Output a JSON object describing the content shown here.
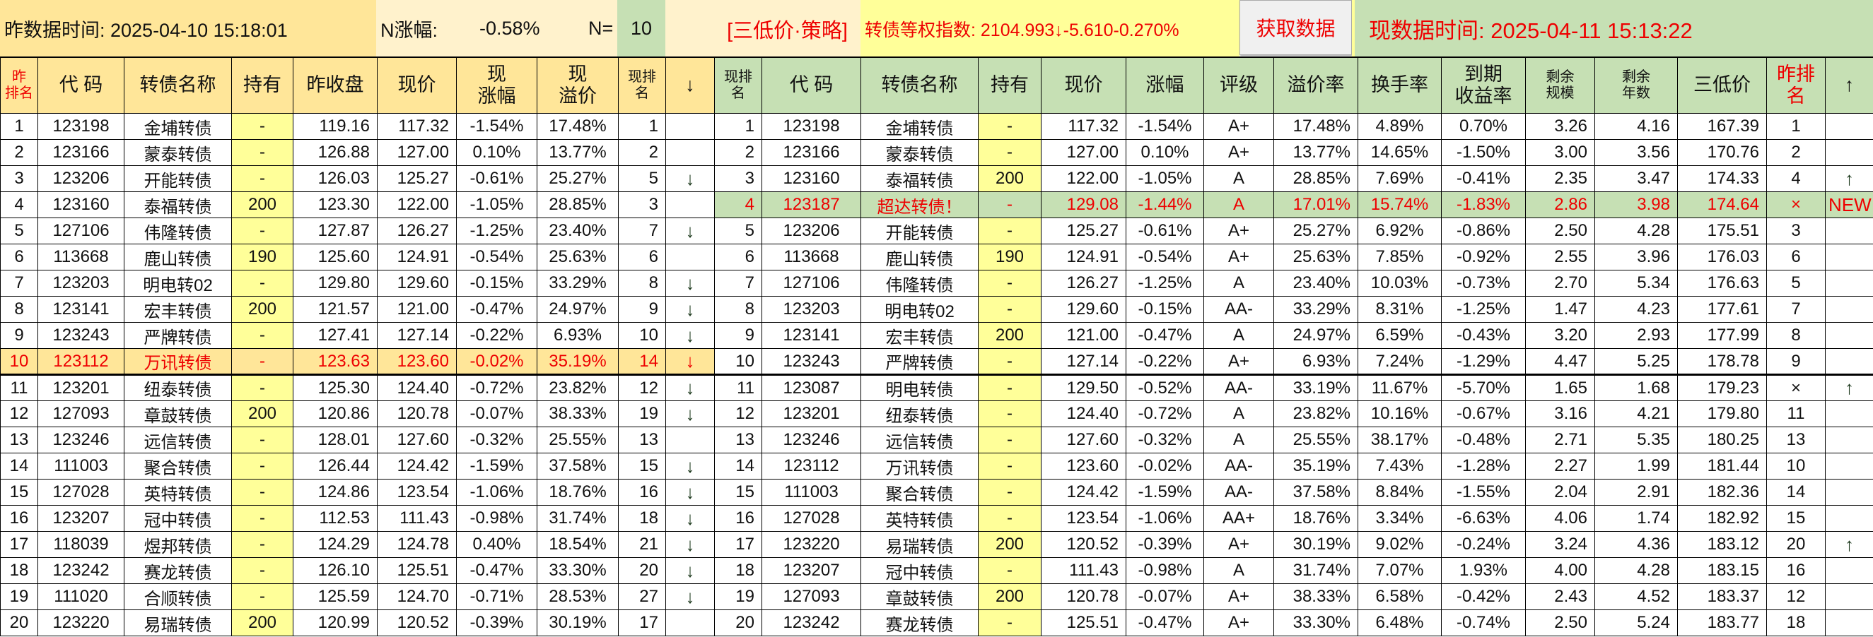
{
  "top": {
    "yesterday_time": "昨数据时间: 2025-04-10 15:18:01",
    "n_change_label": "N涨幅:",
    "n_change_value": "-0.58%",
    "n_label": "N=",
    "n_value": "10",
    "strategy": "[三低价·策略]",
    "index_text": "转债等权指数:  2104.993↓-5.610-0.270%",
    "fetch_button": "获取数据",
    "now_time": "现数据时间: 2025-04-11 15:13:22"
  },
  "colors": {
    "left_header": "#ffe699",
    "right_header": "#c6e0b4",
    "hold": "#ffff99",
    "alert": "#ff0000"
  },
  "left": {
    "headers": [
      "昨\n排名",
      "代 码",
      "转债名称",
      "持有",
      "昨收盘",
      "现价",
      "现\n涨幅",
      "现\n溢价",
      "现排名",
      "↓"
    ],
    "rows": [
      [
        "1",
        "123198",
        "金埔转债",
        "-",
        "119.16",
        "117.32",
        "-1.54%",
        "17.48%",
        "1",
        ""
      ],
      [
        "2",
        "123166",
        "蒙泰转债",
        "-",
        "126.88",
        "127.00",
        "0.10%",
        "13.77%",
        "2",
        ""
      ],
      [
        "3",
        "123206",
        "开能转债",
        "-",
        "126.03",
        "125.27",
        "-0.61%",
        "25.27%",
        "5",
        "↓"
      ],
      [
        "4",
        "123160",
        "泰福转债",
        "200",
        "123.30",
        "122.00",
        "-1.05%",
        "28.85%",
        "3",
        ""
      ],
      [
        "5",
        "127106",
        "伟隆转债",
        "-",
        "127.87",
        "126.27",
        "-1.25%",
        "23.40%",
        "7",
        "↓"
      ],
      [
        "6",
        "113668",
        "鹿山转债",
        "190",
        "125.60",
        "124.91",
        "-0.54%",
        "25.63%",
        "6",
        ""
      ],
      [
        "7",
        "123203",
        "明电转02",
        "-",
        "129.80",
        "129.60",
        "-0.15%",
        "33.29%",
        "8",
        "↓"
      ],
      [
        "8",
        "123141",
        "宏丰转债",
        "200",
        "121.57",
        "121.00",
        "-0.47%",
        "24.97%",
        "9",
        "↓"
      ],
      [
        "9",
        "123243",
        "严牌转债",
        "-",
        "127.41",
        "127.14",
        "-0.22%",
        "6.93%",
        "10",
        "↓"
      ],
      [
        "10",
        "123112",
        "万讯转债",
        "-",
        "123.63",
        "123.60",
        "-0.02%",
        "35.19%",
        "14",
        "↓"
      ],
      [
        "11",
        "123201",
        "纽泰转债",
        "-",
        "125.30",
        "124.40",
        "-0.72%",
        "23.82%",
        "12",
        "↓"
      ],
      [
        "12",
        "127093",
        "章鼓转债",
        "200",
        "120.86",
        "120.78",
        "-0.07%",
        "38.33%",
        "19",
        "↓"
      ],
      [
        "13",
        "123246",
        "远信转债",
        "-",
        "128.01",
        "127.60",
        "-0.32%",
        "25.55%",
        "13",
        ""
      ],
      [
        "14",
        "111003",
        "聚合转债",
        "-",
        "126.44",
        "124.42",
        "-1.59%",
        "37.58%",
        "15",
        "↓"
      ],
      [
        "15",
        "127028",
        "英特转债",
        "-",
        "124.86",
        "123.54",
        "-1.06%",
        "18.76%",
        "16",
        "↓"
      ],
      [
        "16",
        "123207",
        "冠中转债",
        "-",
        "112.53",
        "111.43",
        "-0.98%",
        "31.74%",
        "18",
        "↓"
      ],
      [
        "17",
        "118039",
        "煜邦转债",
        "-",
        "124.29",
        "124.78",
        "0.40%",
        "18.54%",
        "21",
        "↓"
      ],
      [
        "18",
        "123242",
        "赛龙转债",
        "-",
        "126.10",
        "125.51",
        "-0.47%",
        "33.30%",
        "20",
        "↓"
      ],
      [
        "19",
        "111020",
        "合顺转债",
        "-",
        "125.59",
        "124.70",
        "-0.71%",
        "28.53%",
        "27",
        "↓"
      ],
      [
        "20",
        "123220",
        "易瑞转债",
        "200",
        "120.99",
        "120.52",
        "-0.39%",
        "30.19%",
        "17",
        ""
      ]
    ],
    "highlight_row": 10
  },
  "right": {
    "headers": [
      "现排名",
      "代 码",
      "转债名称",
      "持有",
      "现价",
      "涨幅",
      "评级",
      "溢价率",
      "换手率",
      "到期\n收益率",
      "剩余\n规模",
      "剩余\n年数",
      "三低价",
      "昨排名",
      "↑"
    ],
    "rows": [
      [
        "1",
        "123198",
        "金埔转债",
        "-",
        "117.32",
        "-1.54%",
        "A+",
        "17.48%",
        "4.89%",
        "0.70%",
        "3.26",
        "4.16",
        "167.39",
        "1",
        ""
      ],
      [
        "2",
        "123166",
        "蒙泰转债",
        "-",
        "127.00",
        "0.10%",
        "A+",
        "13.77%",
        "14.65%",
        "-1.50%",
        "3.00",
        "3.56",
        "170.76",
        "2",
        ""
      ],
      [
        "3",
        "123160",
        "泰福转债",
        "200",
        "122.00",
        "-1.05%",
        "A",
        "28.85%",
        "7.69%",
        "-0.41%",
        "2.35",
        "3.47",
        "174.33",
        "4",
        "↑"
      ],
      [
        "4",
        "123187",
        "超达转债！",
        "-",
        "129.08",
        "-1.44%",
        "A",
        "17.01%",
        "15.74%",
        "-1.83%",
        "2.86",
        "3.98",
        "174.64",
        "×",
        "NEW"
      ],
      [
        "5",
        "123206",
        "开能转债",
        "-",
        "125.27",
        "-0.61%",
        "A+",
        "25.27%",
        "6.92%",
        "-0.86%",
        "2.50",
        "4.28",
        "175.51",
        "3",
        ""
      ],
      [
        "6",
        "113668",
        "鹿山转债",
        "190",
        "124.91",
        "-0.54%",
        "A+",
        "25.63%",
        "7.85%",
        "-0.92%",
        "2.55",
        "3.96",
        "176.03",
        "6",
        ""
      ],
      [
        "7",
        "127106",
        "伟隆转债",
        "-",
        "126.27",
        "-1.25%",
        "A",
        "23.40%",
        "10.03%",
        "-0.73%",
        "2.70",
        "5.34",
        "176.63",
        "5",
        ""
      ],
      [
        "8",
        "123203",
        "明电转02",
        "-",
        "129.60",
        "-0.15%",
        "AA-",
        "33.29%",
        "8.31%",
        "-1.25%",
        "1.47",
        "4.23",
        "177.61",
        "7",
        ""
      ],
      [
        "9",
        "123141",
        "宏丰转债",
        "200",
        "121.00",
        "-0.47%",
        "A",
        "24.97%",
        "6.59%",
        "-0.43%",
        "3.20",
        "2.93",
        "177.99",
        "8",
        ""
      ],
      [
        "10",
        "123243",
        "严牌转债",
        "-",
        "127.14",
        "-0.22%",
        "A+",
        "6.93%",
        "7.24%",
        "-1.29%",
        "4.47",
        "5.25",
        "178.78",
        "9",
        ""
      ],
      [
        "11",
        "123087",
        "明电转债",
        "-",
        "129.50",
        "-0.52%",
        "AA-",
        "33.19%",
        "11.67%",
        "-5.70%",
        "1.65",
        "1.68",
        "179.23",
        "×",
        "↑"
      ],
      [
        "12",
        "123201",
        "纽泰转债",
        "-",
        "124.40",
        "-0.72%",
        "A",
        "23.82%",
        "10.16%",
        "-0.67%",
        "3.16",
        "4.21",
        "179.80",
        "11",
        ""
      ],
      [
        "13",
        "123246",
        "远信转债",
        "-",
        "127.60",
        "-0.32%",
        "A",
        "25.55%",
        "38.17%",
        "-0.48%",
        "2.71",
        "5.35",
        "180.25",
        "13",
        ""
      ],
      [
        "14",
        "123112",
        "万讯转债",
        "-",
        "123.60",
        "-0.02%",
        "AA-",
        "35.19%",
        "7.43%",
        "-1.28%",
        "2.27",
        "1.99",
        "181.44",
        "10",
        ""
      ],
      [
        "15",
        "111003",
        "聚合转债",
        "-",
        "124.42",
        "-1.59%",
        "AA-",
        "37.58%",
        "8.84%",
        "-1.55%",
        "2.04",
        "2.91",
        "182.36",
        "14",
        ""
      ],
      [
        "16",
        "127028",
        "英特转债",
        "-",
        "123.54",
        "-1.06%",
        "AA+",
        "18.76%",
        "3.34%",
        "-6.63%",
        "4.06",
        "1.74",
        "182.92",
        "15",
        ""
      ],
      [
        "17",
        "123220",
        "易瑞转债",
        "200",
        "120.52",
        "-0.39%",
        "A+",
        "30.19%",
        "9.02%",
        "-0.24%",
        "3.24",
        "4.36",
        "183.12",
        "20",
        "↑"
      ],
      [
        "18",
        "123207",
        "冠中转债",
        "-",
        "111.43",
        "-0.98%",
        "A",
        "31.74%",
        "7.07%",
        "1.93%",
        "4.00",
        "4.28",
        "183.15",
        "16",
        ""
      ],
      [
        "19",
        "127093",
        "章鼓转债",
        "200",
        "120.78",
        "-0.07%",
        "A+",
        "38.33%",
        "6.58%",
        "-0.42%",
        "2.43",
        "4.52",
        "183.37",
        "12",
        ""
      ],
      [
        "20",
        "123242",
        "赛龙转债",
        "-",
        "125.51",
        "-0.47%",
        "A+",
        "33.30%",
        "6.48%",
        "-0.74%",
        "2.50",
        "5.24",
        "183.77",
        "18",
        ""
      ]
    ],
    "highlight_row": 4
  }
}
